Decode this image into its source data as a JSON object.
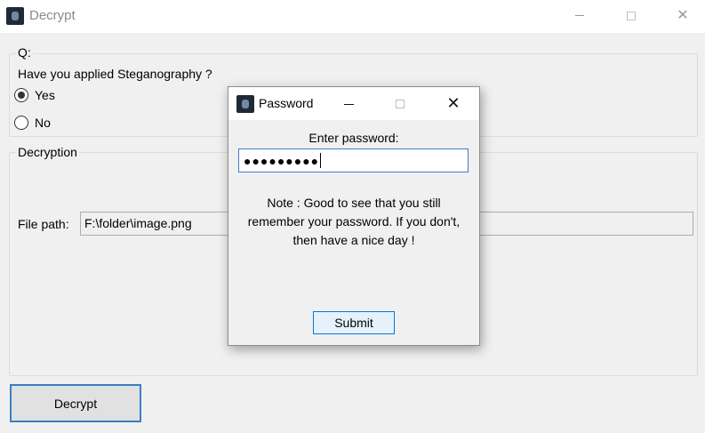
{
  "window": {
    "title": "Decrypt"
  },
  "question_group": {
    "legend": "Q:",
    "question": "Have you applied Steganography ?",
    "options": [
      {
        "label": "Yes",
        "selected": true
      },
      {
        "label": "No",
        "selected": false
      }
    ]
  },
  "decryption_group": {
    "legend": "Decryption",
    "file_path_label": "File path:",
    "file_path_value": "F:\\folder\\image.png"
  },
  "decrypt_button": {
    "label": "Decrypt"
  },
  "password_dialog": {
    "title": "Password",
    "prompt": "Enter password:",
    "masked_value": "●●●●●●●●●",
    "note": "Note : Good to see that you still remember your password. If you don't, then have a nice day !",
    "submit_label": "Submit"
  },
  "colors": {
    "accent": "#0078d7",
    "window_bg": "#f0f0f0",
    "titlebar_bg": "#ffffff"
  },
  "icons": {
    "app": "app-icon",
    "minimize": "minimize-icon",
    "maximize": "maximize-icon",
    "close": "close-icon"
  }
}
